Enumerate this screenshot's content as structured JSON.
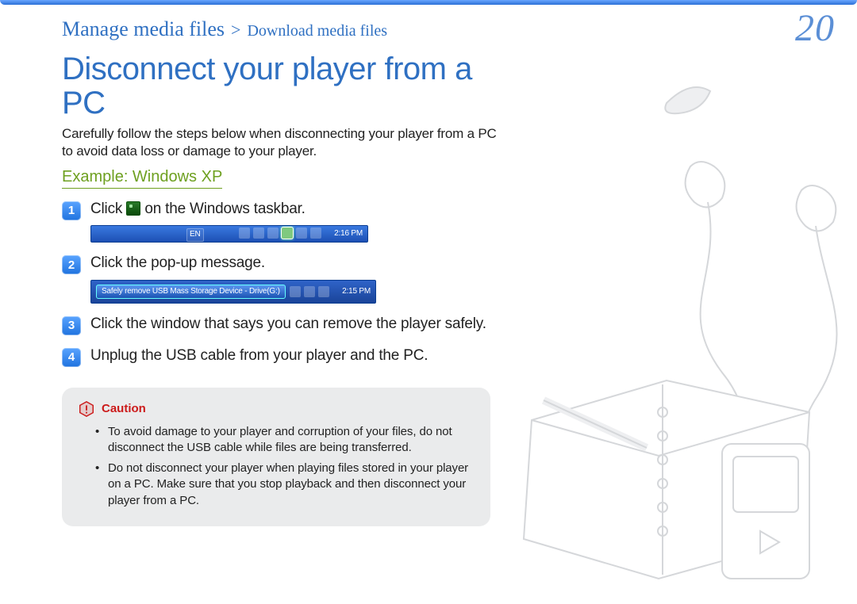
{
  "breadcrumb": {
    "level1": "Manage media files",
    "separator": ">",
    "level2": "Download media files"
  },
  "page_number": "20",
  "title": "Disconnect your player from a PC",
  "intro": "Carefully follow the steps below when disconnecting your player from a PC to avoid data loss or damage to your player.",
  "example_label": "Example: Windows XP",
  "steps": [
    {
      "num": "1",
      "text_before": "Click ",
      "text_after": " on the Windows taskbar.",
      "taskbar": {
        "lang": "EN",
        "time": "2:16 PM"
      }
    },
    {
      "num": "2",
      "text": "Click the pop-up message.",
      "popup": {
        "tooltip": "Safely remove USB Mass Storage Device - Drive(G:)",
        "time": "2:15 PM"
      }
    },
    {
      "num": "3",
      "text": "Click the window that says you can remove the player safely."
    },
    {
      "num": "4",
      "text": "Unplug the USB cable from your player and the PC."
    }
  ],
  "caution": {
    "label": "Caution",
    "items": [
      "To avoid damage to your player and corruption of your files, do not disconnect the USB cable while files are being transferred.",
      "Do not disconnect your player when playing files stored in your player on a PC. Make sure that you stop playback and then disconnect your player from a PC."
    ]
  }
}
